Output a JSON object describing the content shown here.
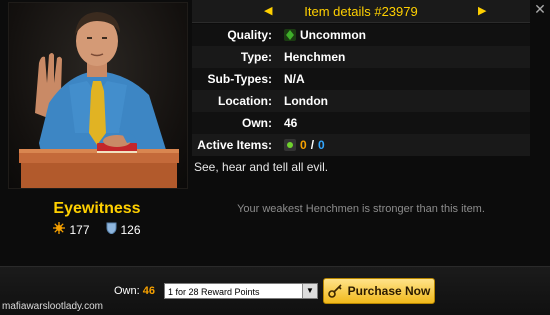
{
  "header": {
    "title": "Item details #23979",
    "prev_icon": "triangle-left",
    "next_icon": "triangle-right",
    "close_icon": "close-x"
  },
  "item": {
    "name": "Eyewitness",
    "attack": "177",
    "defense": "126"
  },
  "details": {
    "rows": [
      {
        "label": "Quality:",
        "value": "Uncommon"
      },
      {
        "label": "Type:",
        "value": "Henchmen"
      },
      {
        "label": "Sub-Types:",
        "value": "N/A"
      },
      {
        "label": "Location:",
        "value": "London"
      },
      {
        "label": "Own:",
        "value": "46"
      }
    ],
    "active_label": "Active Items:",
    "active_used": "0",
    "active_sep": "/",
    "active_total": "0"
  },
  "description": "See, hear and tell all evil.",
  "comparison": "Your weakest Henchmen is stronger than this item.",
  "purchase": {
    "own_label": "Own:",
    "own_value": "46",
    "selected_option": "1 for 28 Reward Points",
    "button_label": "Purchase Now"
  },
  "watermark": "mafiawarslootlady.com",
  "colors": {
    "gold": "#ffd000",
    "orange": "#f7a100",
    "blue": "#33a7ff",
    "uncommon": "#3fae2a"
  }
}
